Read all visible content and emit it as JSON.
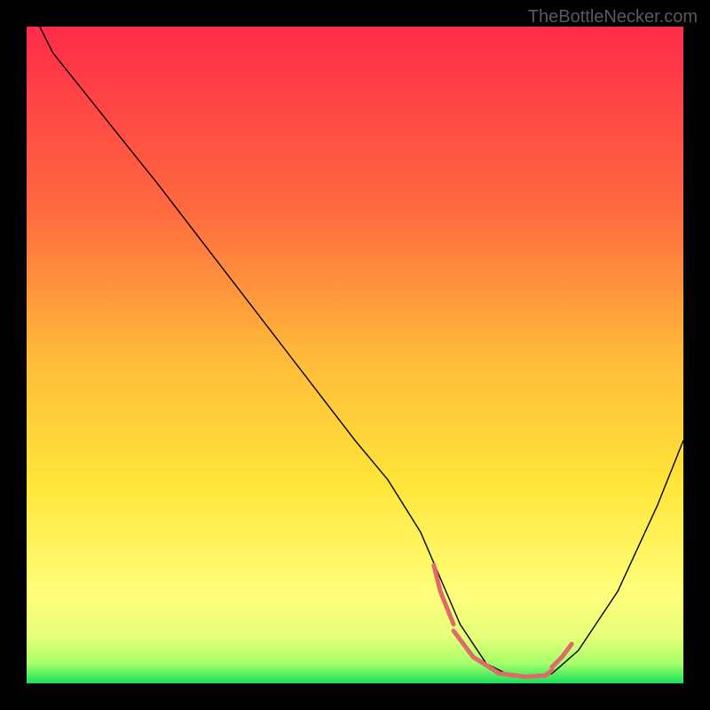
{
  "watermark": "TheBottleNecker.com",
  "chart_data": {
    "type": "line",
    "title": "",
    "xlabel": "",
    "ylabel": "",
    "xlim": [
      0,
      100
    ],
    "ylim": [
      0,
      100
    ],
    "grid": false,
    "background_gradient": {
      "stops": [
        {
          "offset": 0,
          "color": "#ff2b4a"
        },
        {
          "offset": 0.28,
          "color": "#ff6a3f"
        },
        {
          "offset": 0.5,
          "color": "#ffb93a"
        },
        {
          "offset": 0.7,
          "color": "#ffe63a"
        },
        {
          "offset": 0.86,
          "color": "#fffe7a"
        },
        {
          "offset": 0.93,
          "color": "#e6ff7a"
        },
        {
          "offset": 0.97,
          "color": "#a5ff6a"
        },
        {
          "offset": 1.0,
          "color": "#18e05a"
        }
      ]
    },
    "series": [
      {
        "name": "curve",
        "color": "#000000",
        "width": 1.4,
        "x": [
          2,
          4,
          8,
          12,
          20,
          30,
          40,
          50,
          55,
          60,
          63,
          66,
          70,
          74,
          78,
          80,
          84,
          90,
          96,
          100
        ],
        "y": [
          100,
          96,
          91,
          86,
          76,
          63,
          50,
          37,
          31,
          23,
          16,
          9,
          3,
          1,
          1,
          1.5,
          5,
          14,
          27,
          37
        ]
      }
    ],
    "highlight": {
      "color": "#e06a6a",
      "width": 5,
      "segments": [
        {
          "x": [
            62,
            63,
            65
          ],
          "y": [
            18,
            14,
            9
          ]
        },
        {
          "x": [
            65,
            68,
            72,
            76,
            79,
            80
          ],
          "y": [
            8,
            4,
            1.5,
            1,
            1.2,
            2
          ]
        },
        {
          "x": [
            80,
            81.5,
            83
          ],
          "y": [
            2.5,
            4,
            6
          ]
        }
      ]
    }
  }
}
